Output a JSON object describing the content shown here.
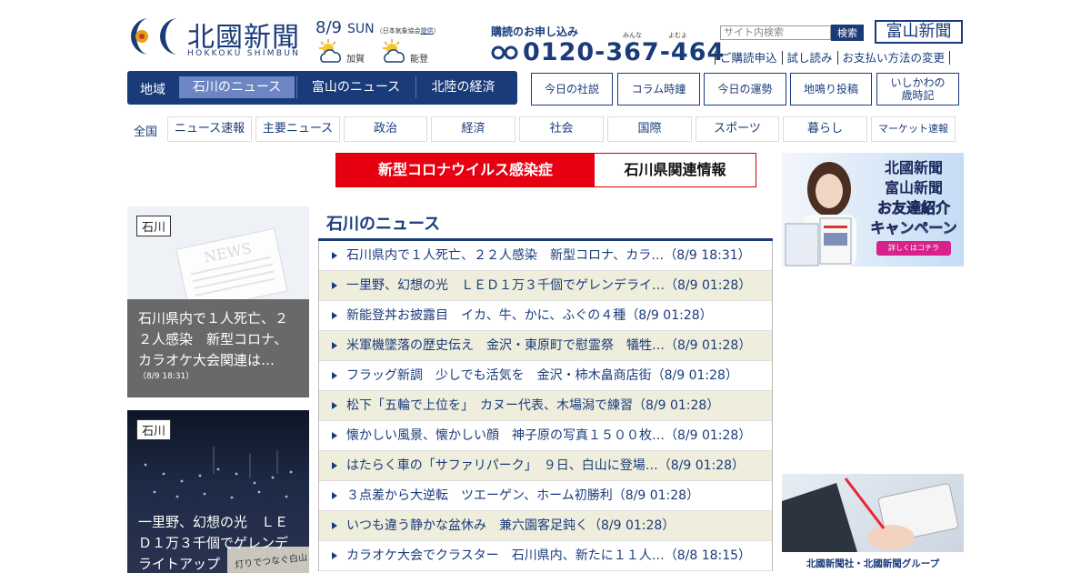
{
  "header": {
    "logo_name": "北國新聞",
    "logo_roman": "HOKKOKU SHIMBUN",
    "date": "8/9",
    "dow": "SUN",
    "weather_source": "（日本気象協会",
    "weather_source_link": "提供",
    "weather_source_end": "）",
    "weather": [
      {
        "area": "加賀",
        "icon": "sun-cloud-icon"
      },
      {
        "area": "能登",
        "icon": "sun-cloud-icon"
      }
    ],
    "subscribe_label": "購読のお申し込み",
    "ruby_minna": "みんな",
    "ruby_yomu": "よむよ",
    "phone": "0120-367-464",
    "search_placeholder": "サイト内検索",
    "search_button": "検索",
    "toyama_logo": "富山新聞",
    "links": [
      "ご購読申込",
      "試し読み",
      "お支払い方法の変更"
    ]
  },
  "region_nav": {
    "label": "地域",
    "tabs": [
      "石川のニュース",
      "富山のニュース",
      "北陸の経済"
    ]
  },
  "feature_buttons": [
    "今日の社説",
    "コラム時鐘",
    "今日の運勢",
    "地鳴り投稿",
    "いしかわの\n歳時記"
  ],
  "category_nav": {
    "all": "全国",
    "items": [
      "ニュース速報",
      "主要ニュース",
      "政治",
      "経済",
      "社会",
      "国際",
      "スポーツ",
      "暮らし",
      "マーケット速報"
    ]
  },
  "corona_banner": {
    "left": "新型コロナウイルス感染症",
    "right": "石川県関連情報"
  },
  "cards": [
    {
      "tag": "石川",
      "caption": "石川県内で１人死亡、２２人感染　新型コロナ、カラオケ大会関連は…",
      "time": "（8/9 18:31）",
      "photo_text": "NEWS"
    },
    {
      "tag": "石川",
      "caption": "一里野、幻想の光　ＬＥＤ１万３千個でゲレンデライトアップ",
      "time": "",
      "photo_text": "灯りでつなぐ白山"
    }
  ],
  "news": {
    "title": "石川のニュース",
    "items": [
      {
        "text": "石川県内で１人死亡、２２人感染　新型コロナ、カラ…",
        "time": "（8/9 18:31）"
      },
      {
        "text": "一里野、幻想の光　ＬＥＤ１万３千個でゲレンデライ…",
        "time": "（8/9 01:28）"
      },
      {
        "text": "新能登丼お披露目　イカ、牛、かに、ふぐの４種",
        "time": "（8/9 01:28）"
      },
      {
        "text": "米軍機墜落の歴史伝え　金沢・東原町で慰霊祭　犠牲…",
        "time": "（8/9 01:28）"
      },
      {
        "text": "フラッグ新調　少しでも活気を　金沢・柿木畠商店街",
        "time": "（8/9 01:28）"
      },
      {
        "text": "松下「五輪で上位を」　カヌー代表、木場潟で練習",
        "time": "（8/9 01:28）"
      },
      {
        "text": "懐かしい風景、懐かしい顔　神子原の写真１５００枚…",
        "time": "（8/9 01:28）"
      },
      {
        "text": "はたらく車の「サファリパーク」　９日、白山に登場…",
        "time": "（8/9 01:28）"
      },
      {
        "text": "３点差から大逆転　ツエーゲン、ホーム初勝利",
        "time": "（8/9 01:28）"
      },
      {
        "text": "いつも違う静かな盆休み　兼六園客足鈍く",
        "time": "（8/9 01:28）"
      },
      {
        "text": "カラオケ大会でクラスター　石川県内、新たに１１人…",
        "time": "（8/8 18:15）"
      }
    ]
  },
  "ads": {
    "ad1_line1": "北國新聞",
    "ad1_line2": "富山新聞",
    "ad1_line3": "お友達紹介",
    "ad1_line4": "キャンペーン",
    "ad1_btn": "詳しくはコチラ",
    "ad2_caption": "北國新聞社・北國新聞グループ"
  },
  "colors": {
    "brand": "#1a3b7a",
    "accent_red": "#e60012",
    "row_alt": "#efeedd"
  }
}
